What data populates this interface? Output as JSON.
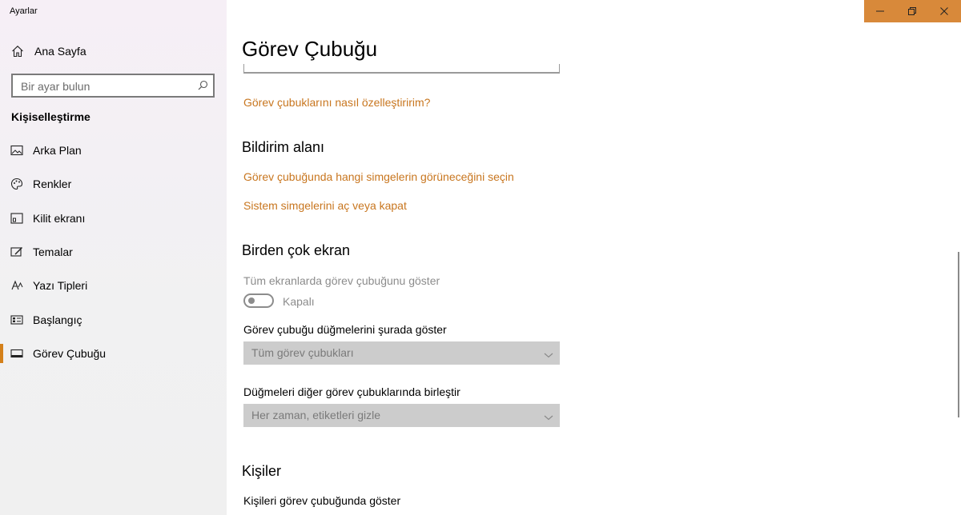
{
  "app": {
    "title": "Ayarlar"
  },
  "sidebar": {
    "home_label": "Ana Sayfa",
    "search_placeholder": "Bir ayar bulun",
    "section_title": "Kişiselleştirme",
    "items": [
      {
        "label": "Arka Plan",
        "icon": "background-image-icon"
      },
      {
        "label": "Renkler",
        "icon": "palette-icon"
      },
      {
        "label": "Kilit ekranı",
        "icon": "lock-screen-icon"
      },
      {
        "label": "Temalar",
        "icon": "themes-icon"
      },
      {
        "label": "Yazı Tipleri",
        "icon": "font-icon"
      },
      {
        "label": "Başlangıç",
        "icon": "start-icon"
      },
      {
        "label": "Görev Çubuğu",
        "icon": "taskbar-icon",
        "active": true
      }
    ]
  },
  "main": {
    "title": "Görev Çubuğu",
    "customize_link": "Görev çubuklarını nasıl özelleştiririm?",
    "notification_area": {
      "heading": "Bildirim alanı",
      "link_icons": "Görev çubuğunda hangi simgelerin görüneceğini seçin",
      "link_system_icons": "Sistem simgelerini aç veya kapat"
    },
    "multiple_displays": {
      "heading": "Birden çok ekran",
      "show_all_label": "Tüm ekranlarda görev çubuğunu göster",
      "toggle_state": "Kapalı",
      "toggle_on": false,
      "show_buttons_label": "Görev çubuğu düğmelerini şurada göster",
      "show_buttons_value": "Tüm görev çubukları",
      "combine_label": "Düğmeleri diğer görev çubuklarında birleştir",
      "combine_value": "Her zaman, etiketleri gizle"
    },
    "people": {
      "heading": "Kişiler",
      "show_people_label": "Kişileri görev çubuğunda göster"
    }
  },
  "colors": {
    "accent": "#d4801a",
    "link": "#c8761f",
    "title_controls_bg": "#d8893a"
  }
}
